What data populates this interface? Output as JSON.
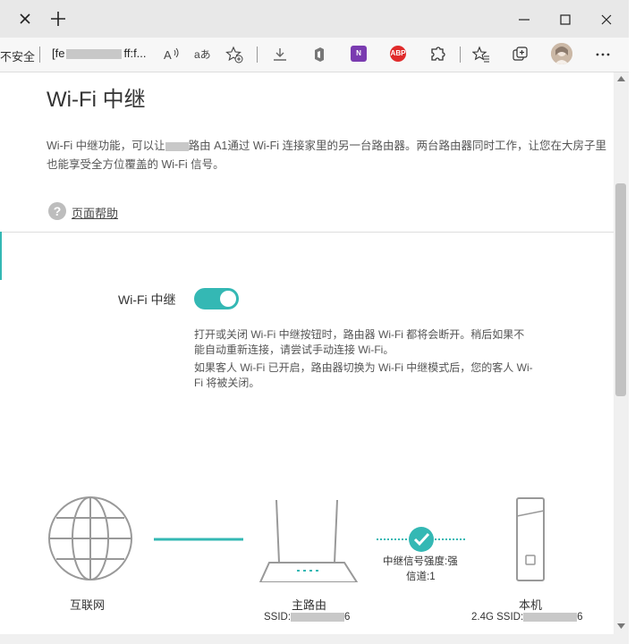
{
  "browser": {
    "security_label": "不安全",
    "url_prefix": "[fe",
    "url_suffix": "ff:f...",
    "read_aloud_icon": "read-aloud-icon",
    "translate_icon": "translate-icon"
  },
  "page": {
    "title": "Wi-Fi 中继",
    "description_part1": "Wi-Fi 中继功能，可以让",
    "description_part2": "路由 A1通过 Wi-Fi 连接家里的另一台路由器。两台路由器同时工作，让您在大房子里也能享受全方位覆盖的 Wi-Fi 信号。",
    "help_link": "页面帮助",
    "repeater_label": "Wi-Fi 中继",
    "toggle_on": true,
    "note1": "打开或关闭 Wi-Fi 中继按钮时，路由器 Wi-Fi 都将会断开。稍后如果不能自动重新连接，请尝试手动连接 Wi-Fi。",
    "note2": "如果客人 Wi-Fi 已开启，路由器切换为 Wi-Fi 中继模式后，您的客人 Wi-Fi 将被关闭。"
  },
  "diagram": {
    "internet_label": "互联网",
    "main_router_label": "主路由",
    "main_ssid_prefix": "SSID:",
    "main_ssid_suffix": "6",
    "signal_strength": "中继信号强度:强",
    "channel": "信道:1",
    "this_device_label": "本机",
    "this_ssid_prefix": "2.4G SSID:",
    "this_ssid_suffix": "6"
  },
  "colors": {
    "accent": "#34b8b4",
    "onenote": "#7a3bb0",
    "adblock": "#e02b2b"
  }
}
